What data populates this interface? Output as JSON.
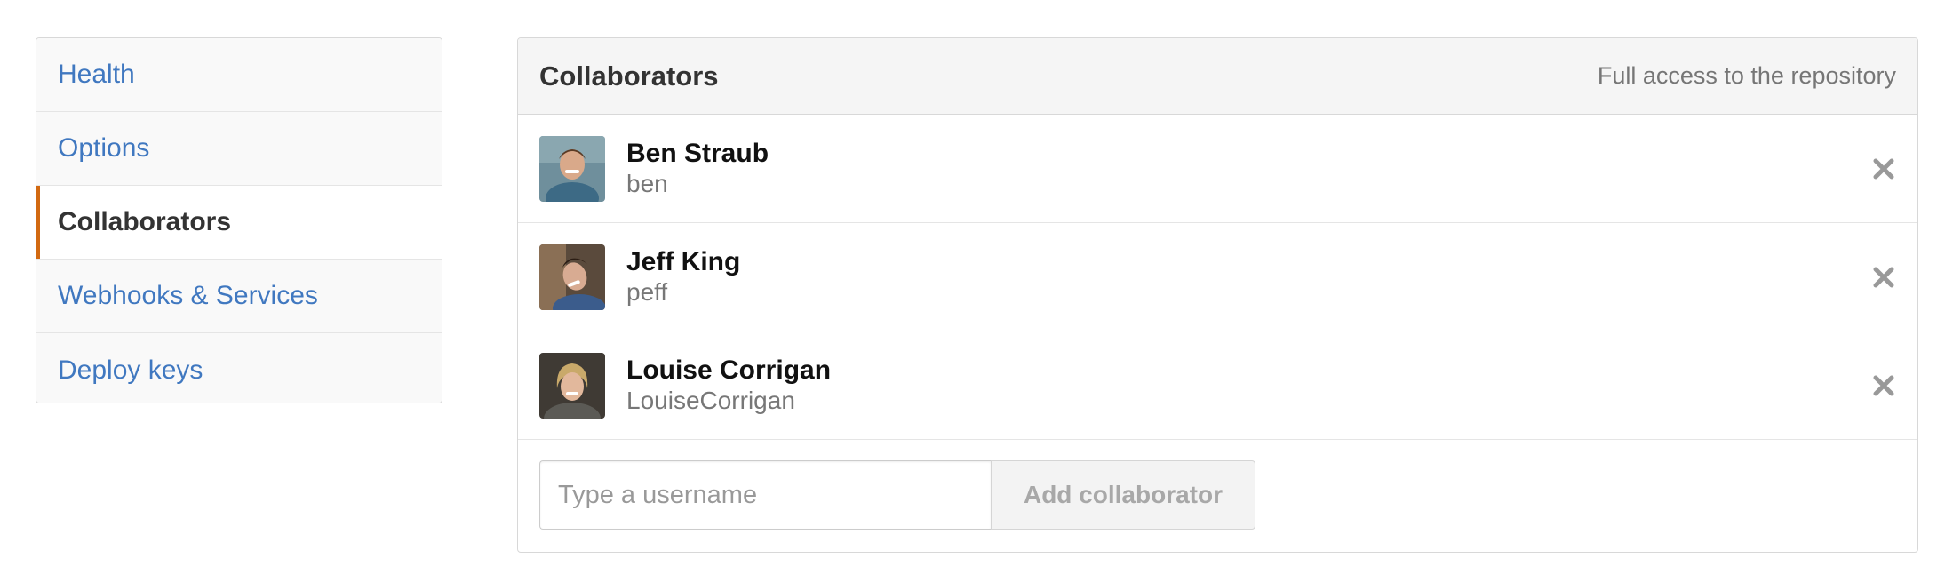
{
  "sidebar": {
    "items": [
      {
        "label": "Health"
      },
      {
        "label": "Options"
      },
      {
        "label": "Collaborators",
        "active": true
      },
      {
        "label": "Webhooks & Services"
      },
      {
        "label": "Deploy keys"
      }
    ]
  },
  "panel": {
    "title": "Collaborators",
    "note": "Full access to the repository"
  },
  "collaborators": [
    {
      "name": "Ben Straub",
      "login": "ben"
    },
    {
      "name": "Jeff King",
      "login": "peff"
    },
    {
      "name": "Louise Corrigan",
      "login": "LouiseCorrigan"
    }
  ],
  "add_form": {
    "placeholder": "Type a username",
    "value": "",
    "button_label": "Add collaborator"
  },
  "colors": {
    "link": "#4078c0",
    "active_marker": "#d26911"
  },
  "icons": {
    "remove": "close-icon"
  }
}
